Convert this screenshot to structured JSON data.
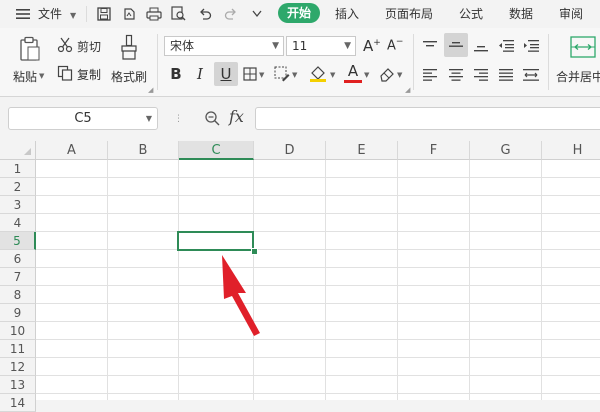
{
  "menubar": {
    "file_label": "文件",
    "tabs": [
      "开始",
      "插入",
      "页面布局",
      "公式",
      "数据",
      "审阅"
    ],
    "active_tab": "开始",
    "accent_color": "#2ea86b"
  },
  "ribbon": {
    "paste_label": "粘贴",
    "cut_label": "剪切",
    "copy_label": "复制",
    "format_painter_label": "格式刷",
    "font_name": "宋体",
    "font_size": "11",
    "merge_label": "合并居中"
  },
  "formula_bar": {
    "name_box_value": "C5",
    "fx_label": "fx"
  },
  "sheet": {
    "columns": [
      "A",
      "B",
      "C",
      "D",
      "E",
      "F",
      "G",
      "H"
    ],
    "rows": [
      "1",
      "2",
      "3",
      "4",
      "5",
      "6",
      "7",
      "8",
      "9",
      "10",
      "11",
      "12",
      "13",
      "14"
    ],
    "active_cell": "C5",
    "selection_color": "#2e8b57",
    "annotation_arrow_color": "#e0202a"
  }
}
